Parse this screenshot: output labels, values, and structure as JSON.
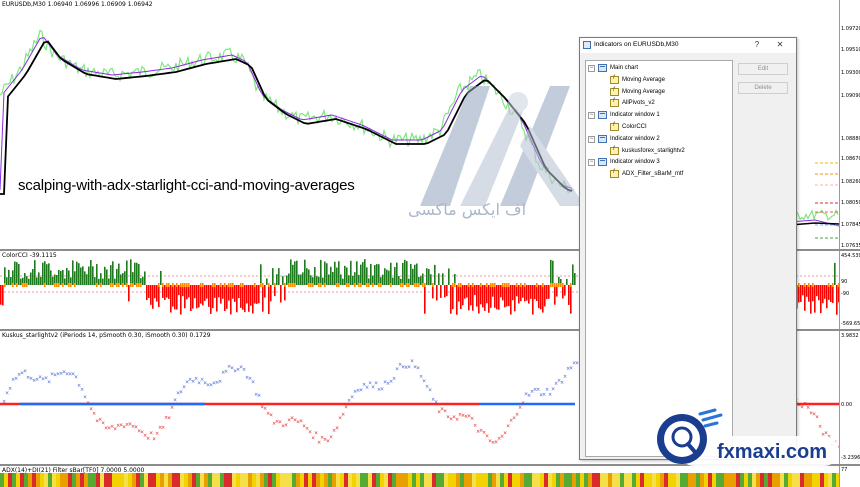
{
  "colors": {
    "price_green": "#7ee77e",
    "ma_black": "#000000",
    "ma_purple": "#8a2be2",
    "cci_green": "#1f7a1f",
    "cci_red": "#ff0000",
    "cci_orange": "#ff8c00",
    "star_blue": "#3b5bd6",
    "star_red": "#e02020",
    "line_blue": "#1e6cff",
    "line_red": "#ff2020"
  },
  "main_chart": {
    "label": "EURUSDb,M30  1.06940 1.06996 1.06909 1.06942",
    "price_scale": [
      "1.09720",
      "1.09510",
      "1.09300",
      "1.09090",
      "1.08880",
      "1.08670",
      "1.08260",
      "1.08050",
      "1.07845",
      "1.07635"
    ]
  },
  "title_overlay": "scalping-with-adx-starlight-cci-and-moving-averages",
  "watermark": {
    "text": "اف ایکس ماکسی"
  },
  "cci_pane": {
    "label": "ColorCCI -39.1115",
    "scale": [
      "454.539",
      "90",
      "-90",
      "-569.652"
    ]
  },
  "starlight_pane": {
    "label": "Kuskus_starlightv2 (iPeriods 14, pSmooth 0.30, iSmooth 0.30)  0.1729",
    "scale": [
      "3.9832",
      "0.00",
      "-3.2396"
    ]
  },
  "adx_pane": {
    "label": "ADX(14)+DI(21) Filter sBar[TF0] 7.0000 5.0000",
    "scale": [
      "77"
    ]
  },
  "dialog": {
    "title": "Indicators on EURUSDb,M30",
    "help_btn": "?",
    "close_btn": "✕",
    "edit_label": "Edit",
    "delete_label": "Delete",
    "tree": [
      {
        "label": "Main chart",
        "kind": "window",
        "level": 0
      },
      {
        "label": "Moving Average",
        "kind": "indicator",
        "level": 1
      },
      {
        "label": "Moving Average",
        "kind": "indicator",
        "level": 1
      },
      {
        "label": "AllPivots_v2",
        "kind": "indicator",
        "level": 1
      },
      {
        "label": "Indicator window 1",
        "kind": "window",
        "level": 0
      },
      {
        "label": "ColorCCI",
        "kind": "indicator",
        "level": 1
      },
      {
        "label": "Indicator window 2",
        "kind": "window",
        "level": 0
      },
      {
        "label": "kuskusforex_starlightv2",
        "kind": "indicator",
        "level": 1
      },
      {
        "label": "Indicator window 3",
        "kind": "window",
        "level": 0
      },
      {
        "label": "ADX_Filter_sBarM_mtf",
        "kind": "indicator",
        "level": 1
      }
    ]
  },
  "badge": {
    "brand": "fxmaxi.com"
  }
}
